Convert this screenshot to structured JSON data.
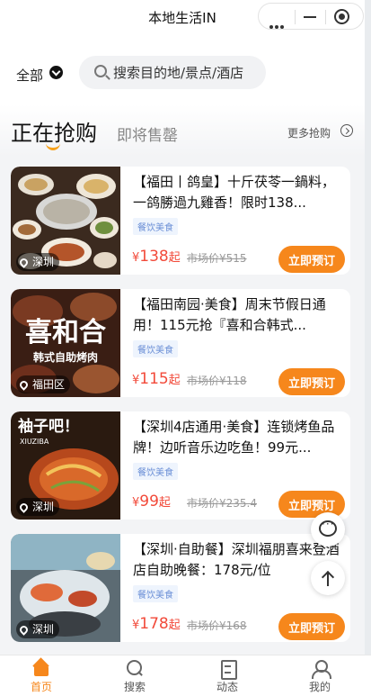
{
  "app": {
    "title": "本地生活IN"
  },
  "header": {
    "city": "全部",
    "search_placeholder": "搜索目的地/景点/酒店"
  },
  "tabs": {
    "active": "正在抢购",
    "inactive": "即将售罄",
    "more": "更多抢购"
  },
  "deals": [
    {
      "location": "深圳",
      "title": "【福田丨鸽皇】十斤茯苓一鍋料，一鸽勝過九雞香！限时138...",
      "category": "餐饮美食",
      "price_symbol": "¥",
      "price": "138",
      "price_suffix": "起",
      "market_price": "市场价¥515",
      "button": "立即预订"
    },
    {
      "location": "福田区",
      "title": "【福田南园·美食】周末节假日通用！115元抢『喜和合韩式...",
      "category": "餐饮美食",
      "price_symbol": "¥",
      "price": "115",
      "price_suffix": "起",
      "market_price": "市场价¥118",
      "button": "立即预订"
    },
    {
      "location": "深圳",
      "title": "【深圳4店通用·美食】连锁烤鱼品牌！边听音乐边吃鱼！99元...",
      "category": "餐饮美食",
      "price_symbol": "¥",
      "price": "99",
      "price_suffix": "起",
      "market_price": "市场价¥235.4",
      "button": "立即预订"
    },
    {
      "location": "深圳",
      "title": "【深圳·自助餐】深圳福朋喜来登酒店自助晚餐：178元/位",
      "category": "餐饮美食",
      "price_symbol": "¥",
      "price": "178",
      "price_suffix": "起",
      "market_price": "市场价¥168",
      "button": "立即预订"
    }
  ],
  "thumb_overlays": {
    "deal2_line1": "喜和合",
    "deal2_line2": "韩式自助烤肉",
    "deal3_brand": "袖子吧！",
    "deal3_sub": "XIUZIBA"
  },
  "tabbar": {
    "home": "首页",
    "search": "搜索",
    "feed": "动态",
    "mine": "我的"
  },
  "colors": {
    "accent": "#f6871c",
    "price": "#f24a3a",
    "category_text": "#6b8fd6"
  }
}
